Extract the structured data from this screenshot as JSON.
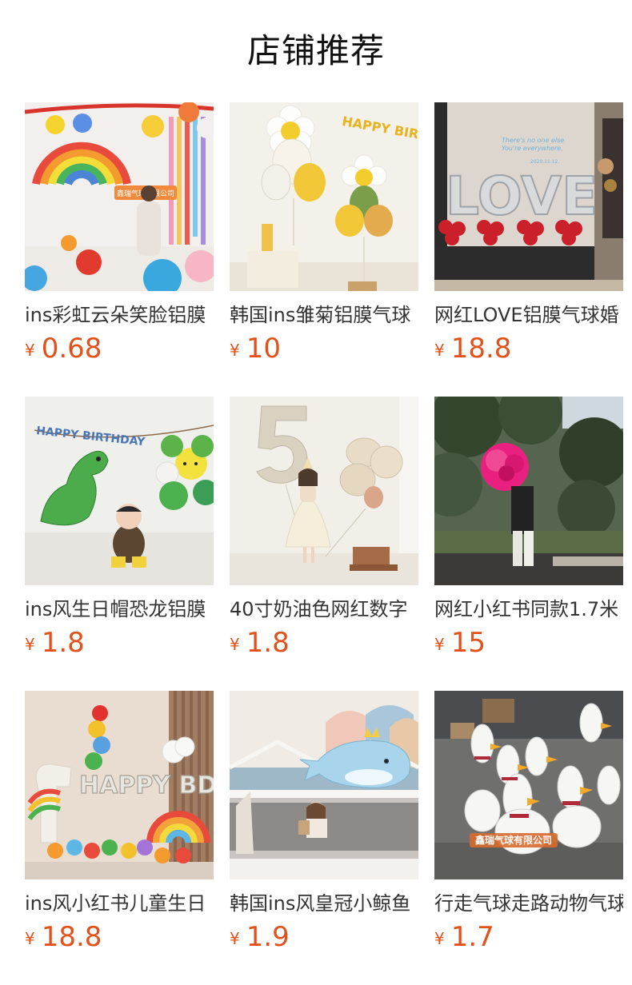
{
  "header": {
    "title": "店铺推荐"
  },
  "currency_symbol": "¥",
  "products": [
    {
      "name": "ins彩虹云朵笑脸铝膜",
      "price": "0.68",
      "image_icon": "rainbow-balloon-photo-icon",
      "image_text": "鑫瑞气球有限公司"
    },
    {
      "name": "韩国ins雏菊铝膜气球",
      "price": "10",
      "image_icon": "daisy-balloon-photo-icon",
      "image_text": "HAPPY BIRTH"
    },
    {
      "name": "网红LOVE铝膜气球婚",
      "price": "18.8",
      "image_icon": "love-balloon-photo-icon",
      "image_text": "There's no one else You're everywhere. 2020.11.12."
    },
    {
      "name": "ins风生日帽恐龙铝膜",
      "price": "1.8",
      "image_icon": "dinosaur-balloon-photo-icon",
      "image_text": "HAPPY BIRTHDAY"
    },
    {
      "name": "40寸奶油色网红数字",
      "price": "1.8",
      "image_icon": "number-five-balloon-photo-icon",
      "image_text": ""
    },
    {
      "name": "网红小红书同款1.7米",
      "price": "15",
      "image_icon": "rose-balloon-photo-icon",
      "image_text": ""
    },
    {
      "name": "ins风小红书儿童生日",
      "price": "18.8",
      "image_icon": "happy-bday-balloon-photo-icon",
      "image_text": "HAPPY BDAY"
    },
    {
      "name": "韩国ins风皇冠小鲸鱼",
      "price": "1.9",
      "image_icon": "whale-balloon-photo-icon",
      "image_text": ""
    },
    {
      "name": "行走气球走路动物气球",
      "price": "1.7",
      "image_icon": "duck-balloon-photo-icon",
      "image_text": "鑫瑞气球有限公司"
    }
  ]
}
